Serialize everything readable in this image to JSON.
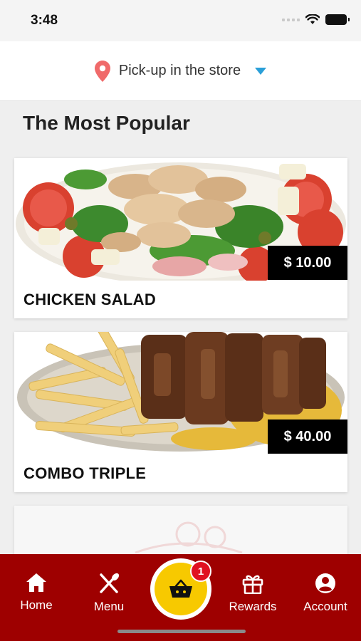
{
  "status_bar": {
    "time": "3:48"
  },
  "pickup": {
    "label": "Pick-up in the store",
    "pin_color": "#f06a6a",
    "caret_color": "#2a9fd8"
  },
  "section": {
    "title": "The Most Popular"
  },
  "products": [
    {
      "name": "CHICKEN SALAD",
      "price": "$ 10.00"
    },
    {
      "name": "COMBO TRIPLE",
      "price": "$ 40.00"
    }
  ],
  "tab_bar": {
    "background": "#9e0000",
    "items": [
      {
        "label": "Home",
        "icon": "home-icon"
      },
      {
        "label": "Menu",
        "icon": "utensils-icon"
      },
      {
        "label": "Rewards",
        "icon": "gift-icon"
      },
      {
        "label": "Account",
        "icon": "account-icon"
      }
    ],
    "cart": {
      "icon": "basket-icon",
      "badge_count": "1",
      "color": "#f7c900"
    }
  }
}
